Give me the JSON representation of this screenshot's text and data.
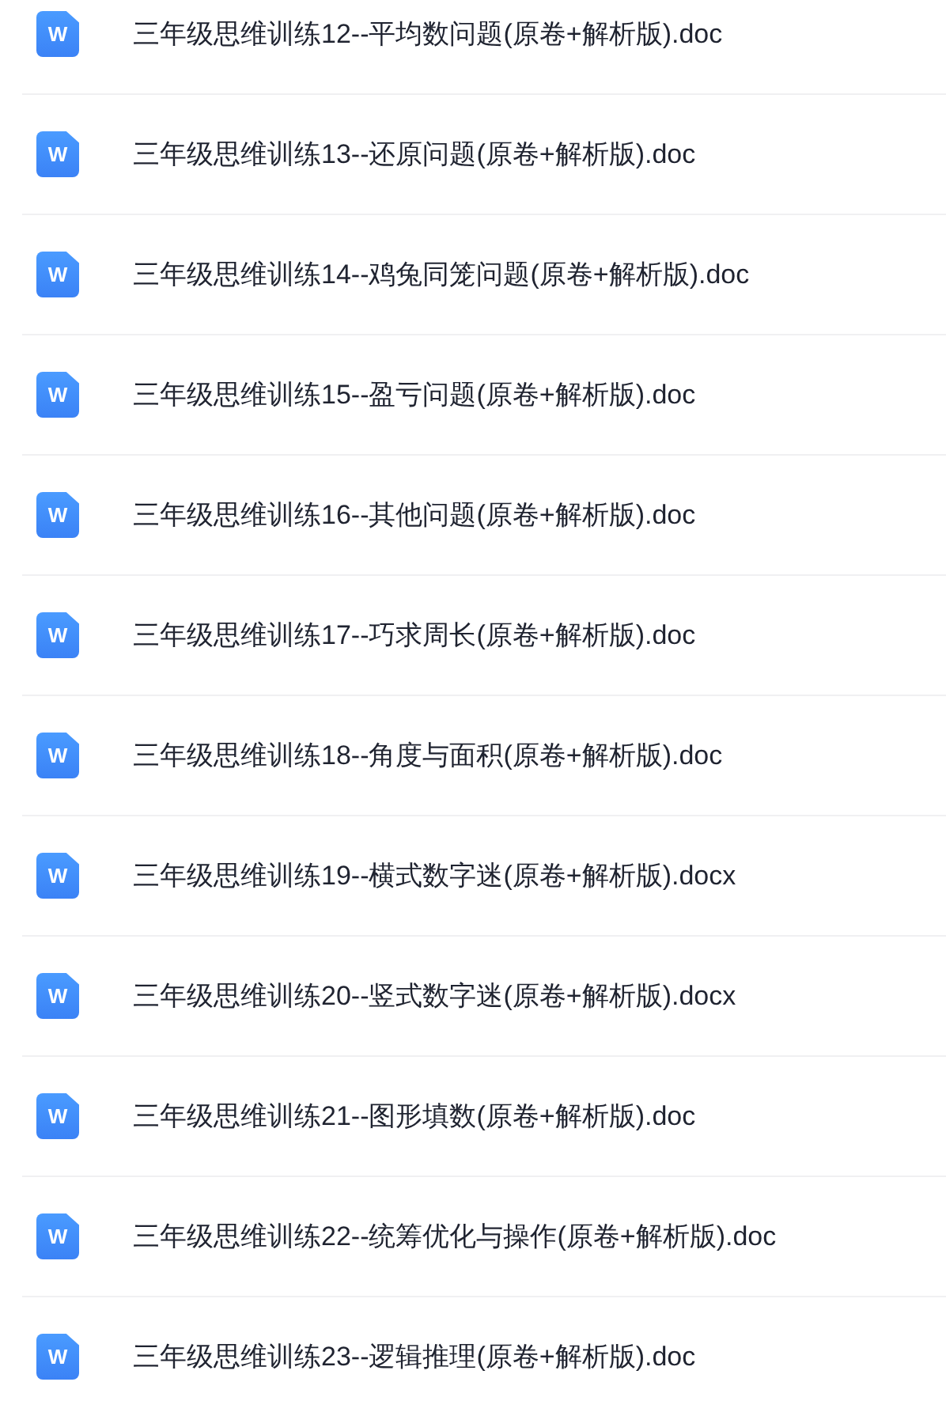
{
  "files": [
    {
      "icon_letter": "W",
      "name": "三年级思维训练12--平均数问题(原卷+解析版).doc"
    },
    {
      "icon_letter": "W",
      "name": "三年级思维训练13--还原问题(原卷+解析版).doc"
    },
    {
      "icon_letter": "W",
      "name": "三年级思维训练14--鸡兔同笼问题(原卷+解析版).doc"
    },
    {
      "icon_letter": "W",
      "name": "三年级思维训练15--盈亏问题(原卷+解析版).doc"
    },
    {
      "icon_letter": "W",
      "name": "三年级思维训练16--其他问题(原卷+解析版).doc"
    },
    {
      "icon_letter": "W",
      "name": "三年级思维训练17--巧求周长(原卷+解析版).doc"
    },
    {
      "icon_letter": "W",
      "name": "三年级思维训练18--角度与面积(原卷+解析版).doc"
    },
    {
      "icon_letter": "W",
      "name": "三年级思维训练19--横式数字迷(原卷+解析版).docx"
    },
    {
      "icon_letter": "W",
      "name": "三年级思维训练20--竖式数字迷(原卷+解析版).docx"
    },
    {
      "icon_letter": "W",
      "name": "三年级思维训练21--图形填数(原卷+解析版).doc"
    },
    {
      "icon_letter": "W",
      "name": "三年级思维训练22--统筹优化与操作(原卷+解析版).doc"
    },
    {
      "icon_letter": "W",
      "name": "三年级思维训练23--逻辑推理(原卷+解析版).doc"
    }
  ]
}
